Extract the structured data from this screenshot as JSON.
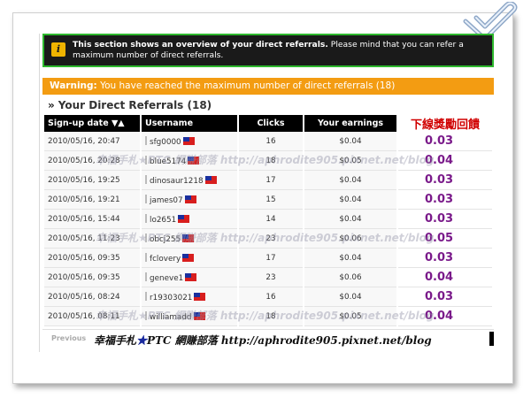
{
  "notice": {
    "bold_text": "This section shows an overview of your direct referrals.",
    "text": "Please mind that you can refer a maximum number of direct referrals."
  },
  "warning": {
    "label": "Warning:",
    "text": "You have reached the maximum number of direct referrals (18)"
  },
  "section_title": "Your Direct Referrals (18)",
  "table": {
    "headers": {
      "date": "Sign-up date ▼▲",
      "username": "Username",
      "clicks": "Clicks",
      "earnings": "Your earnings",
      "bonus": "下線獎勵回饋"
    },
    "rows": [
      {
        "date": "2010/05/16, 20:47",
        "username": "sfg0000",
        "clicks": "16",
        "earnings": "$0.04",
        "bonus": "0.03"
      },
      {
        "date": "2010/05/16, 20:28",
        "username": "blue5174",
        "clicks": "18",
        "earnings": "$0.05",
        "bonus": "0.04"
      },
      {
        "date": "2010/05/16, 19:25",
        "username": "dinosaur1218",
        "clicks": "17",
        "earnings": "$0.04",
        "bonus": "0.03"
      },
      {
        "date": "2010/05/16, 19:21",
        "username": "james07",
        "clicks": "15",
        "earnings": "$0.04",
        "bonus": "0.03"
      },
      {
        "date": "2010/05/16, 15:44",
        "username": "lo2651",
        "clicks": "14",
        "earnings": "$0.04",
        "bonus": "0.03"
      },
      {
        "date": "2010/05/16, 11:23",
        "username": "obcj255",
        "clicks": "23",
        "earnings": "$0.06",
        "bonus": "0.05"
      },
      {
        "date": "2010/05/16, 09:35",
        "username": "fclovery",
        "clicks": "17",
        "earnings": "$0.04",
        "bonus": "0.03"
      },
      {
        "date": "2010/05/16, 09:35",
        "username": "geneve1",
        "clicks": "23",
        "earnings": "$0.06",
        "bonus": "0.04"
      },
      {
        "date": "2010/05/16, 08:24",
        "username": "r19303021",
        "clicks": "16",
        "earnings": "$0.04",
        "bonus": "0.03"
      },
      {
        "date": "2010/05/16, 08:11",
        "username": "williamadd",
        "clicks": "18",
        "earnings": "$0.05",
        "bonus": "0.04"
      }
    ]
  },
  "watermark": "幸福手札★PTC 網賺部落 http://aphrodite905.pixnet.net/blog",
  "footer": {
    "previous": "Previous",
    "blog_prefix": "幸福手札",
    "blog_star": "★",
    "blog_suffix": "PTC 網賺部落 http://aphrodite905.pixnet.net/blog"
  },
  "colors": {
    "warning_bg": "#f39c12",
    "header_bg": "#000000",
    "bonus_text": "#7a1a8a",
    "bonus_header": "#d00000",
    "notice_border": "#2db82d"
  }
}
